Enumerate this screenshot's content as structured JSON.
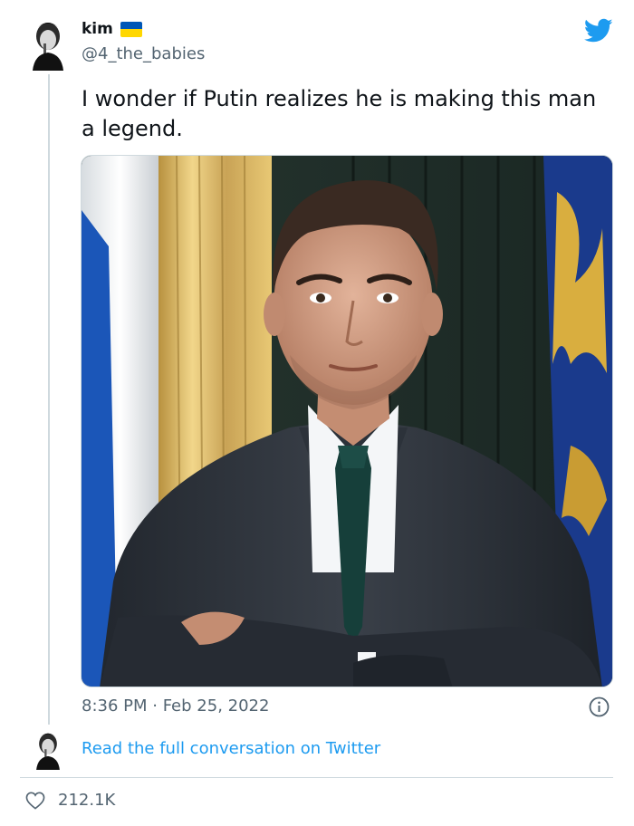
{
  "tweet": {
    "author_name": "kim",
    "author_handle": "@4_the_babies",
    "text": "I wonder if Putin realizes he is making this man a legend.",
    "timestamp": "8:36 PM · Feb 25, 2022",
    "read_link": "Read the full conversation on Twitter",
    "likes": "212.1K"
  },
  "colors": {
    "link": "#1d9bf0",
    "secondary_text": "#536471",
    "flag_blue": "#0057b7",
    "flag_yellow": "#ffd700"
  },
  "icons": {
    "brand": "twitter-bird-icon",
    "info": "info-icon",
    "like": "heart-icon",
    "flag": "ukraine-flag-icon"
  }
}
